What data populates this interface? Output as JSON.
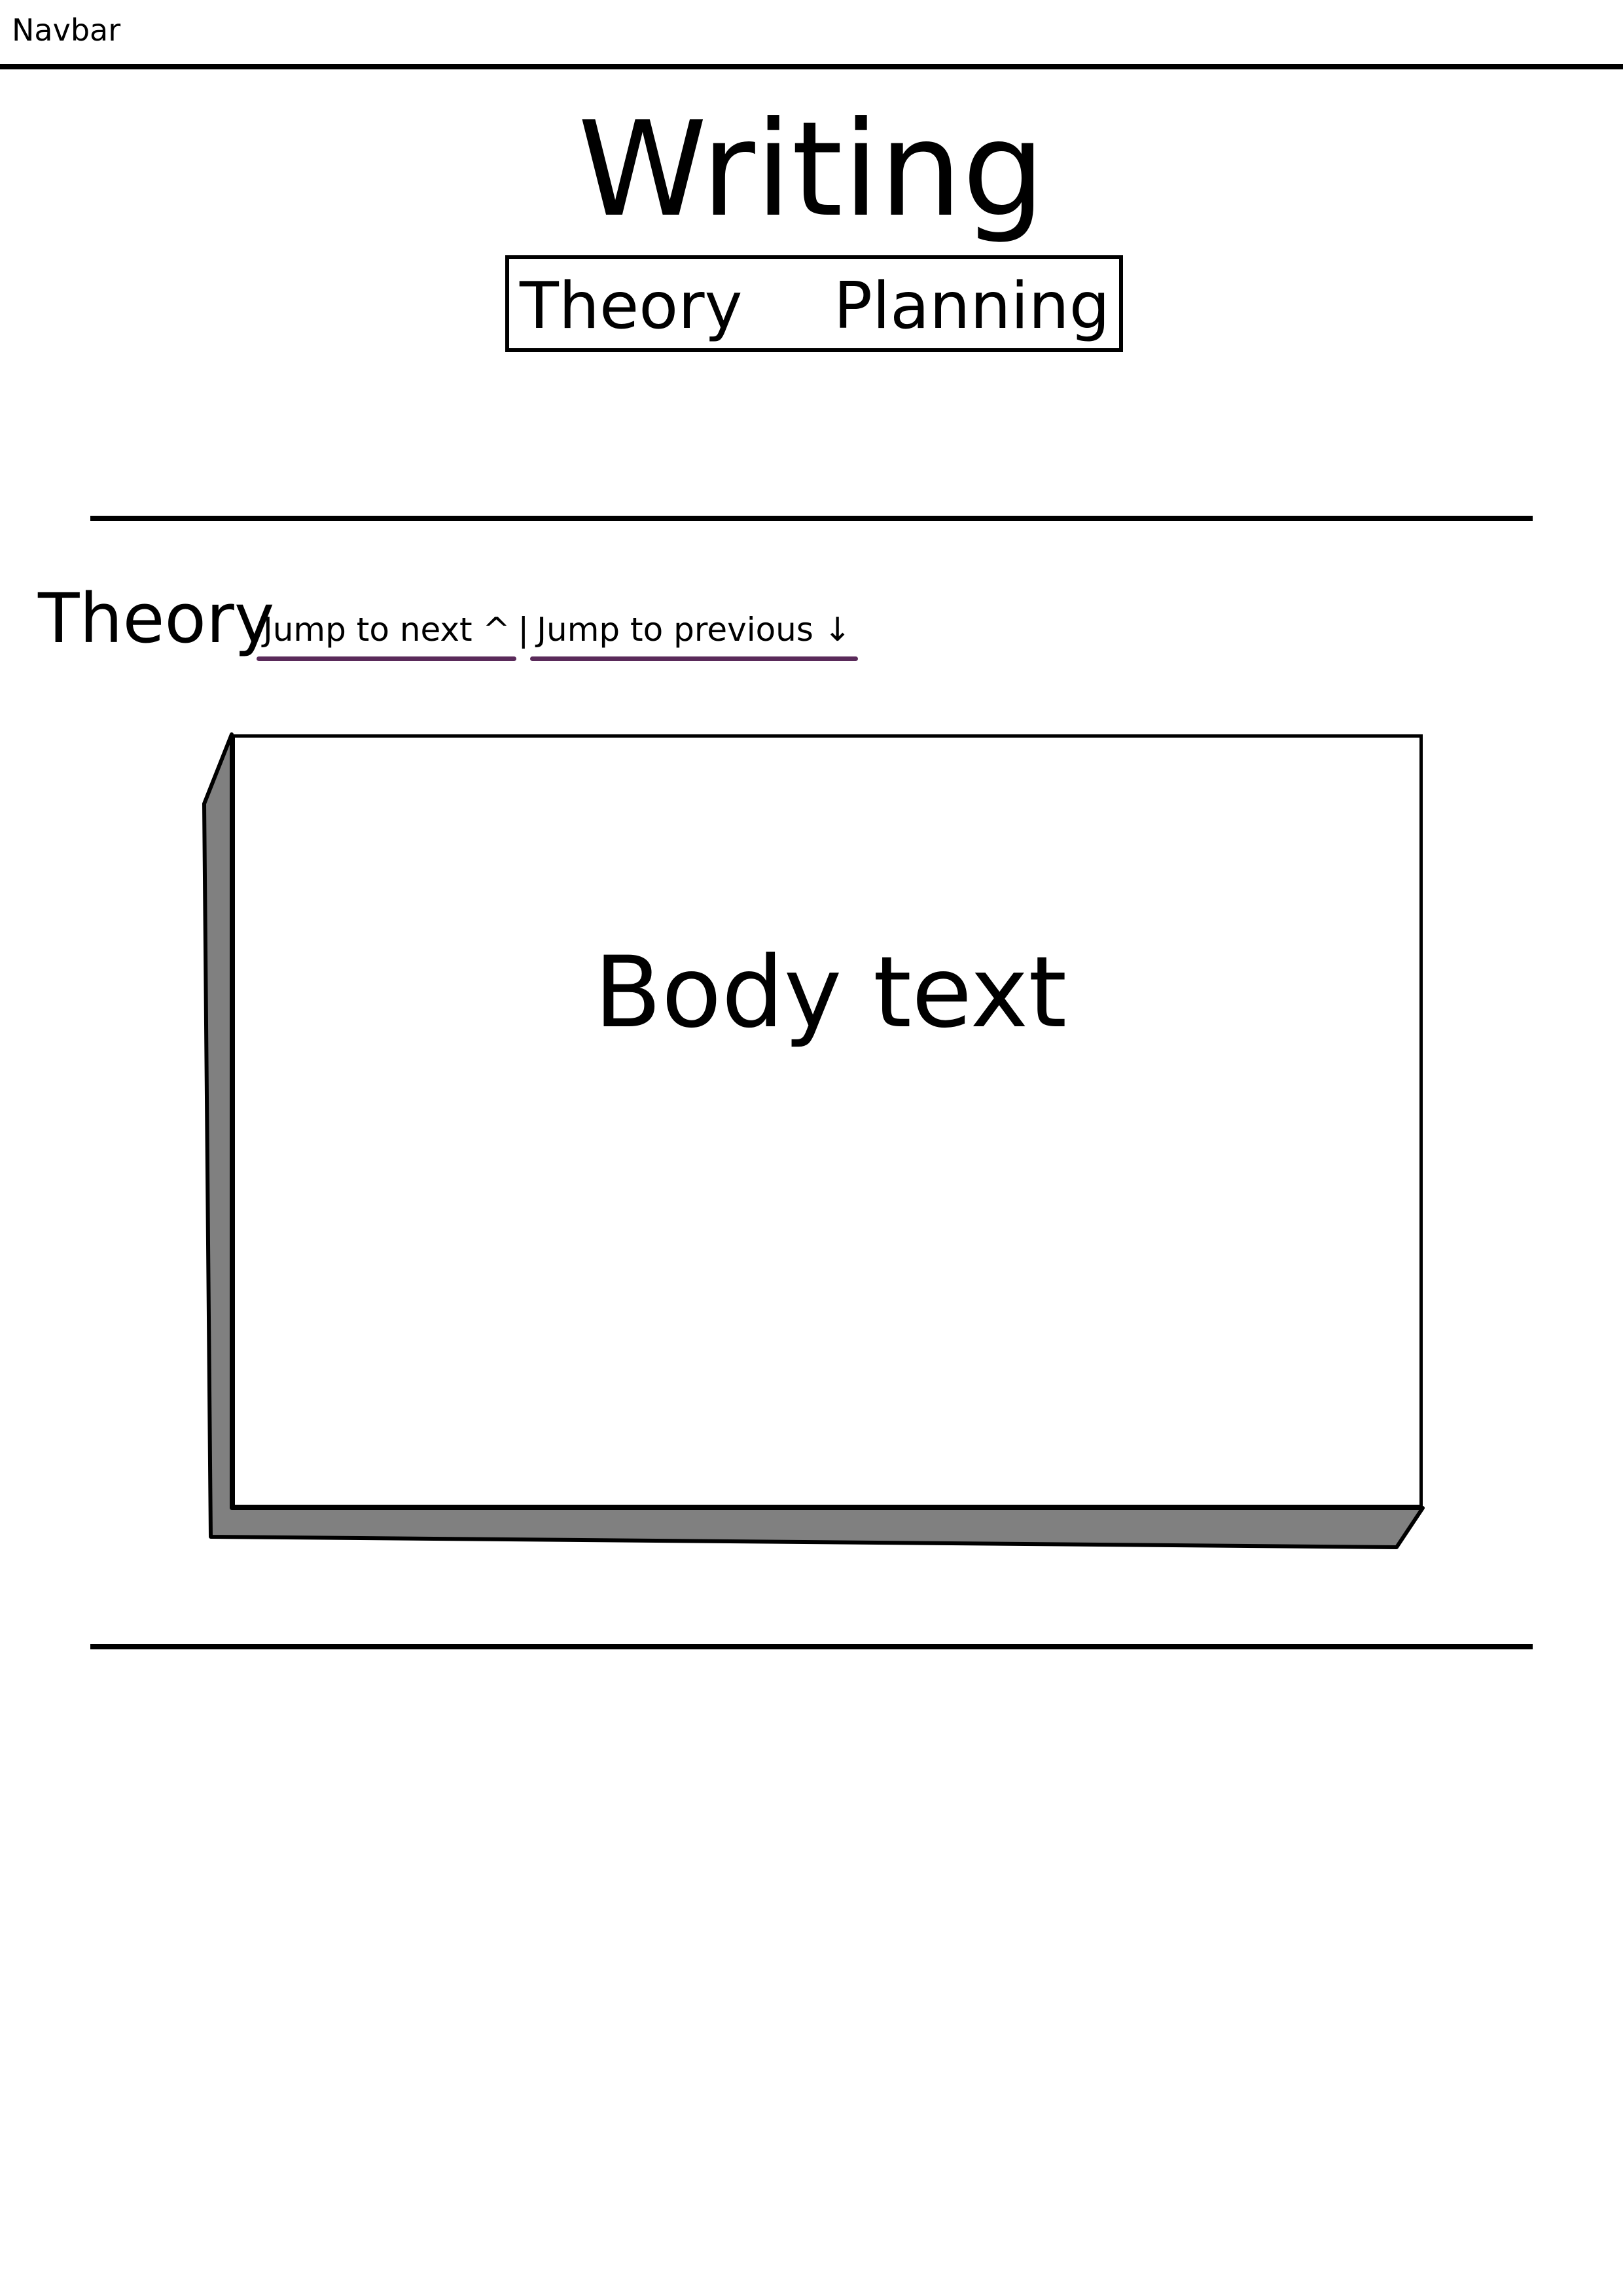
{
  "navbar": {
    "label": "Navbar"
  },
  "page": {
    "title": "Writing"
  },
  "tabs": [
    {
      "label": "Theory"
    },
    {
      "label": "Planning"
    }
  ],
  "section": {
    "heading": "Theory",
    "jump_next": "Jump to next ^",
    "separator": "|",
    "jump_previous": "Jump to previous ↓"
  },
  "card": {
    "body": "Body text"
  },
  "colors": {
    "link_underline": "#5a2a5a",
    "card_shadow": "#808080",
    "rule": "#000000"
  }
}
